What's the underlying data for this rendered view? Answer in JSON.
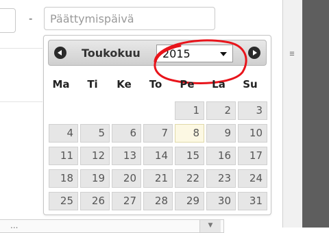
{
  "form": {
    "range_separator": "-",
    "end_date_placeholder": "Päättymispäivä",
    "end_date_value": "",
    "bottom_select_text": "..."
  },
  "scrollbar": {
    "grip_symbol": "≡"
  },
  "datepicker": {
    "month": "Toukokuu",
    "year": "2015",
    "weekdays": [
      "Ma",
      "Ti",
      "Ke",
      "To",
      "Pe",
      "La",
      "Su"
    ],
    "today": "8",
    "weeks": [
      [
        "",
        "",
        "",
        "",
        "1",
        "2",
        "3"
      ],
      [
        "4",
        "5",
        "6",
        "7",
        "8",
        "9",
        "10"
      ],
      [
        "11",
        "12",
        "13",
        "14",
        "15",
        "16",
        "17"
      ],
      [
        "18",
        "19",
        "20",
        "21",
        "22",
        "23",
        "24"
      ],
      [
        "25",
        "26",
        "27",
        "28",
        "29",
        "30",
        "31"
      ]
    ],
    "annotation_color": "#e8141b"
  }
}
